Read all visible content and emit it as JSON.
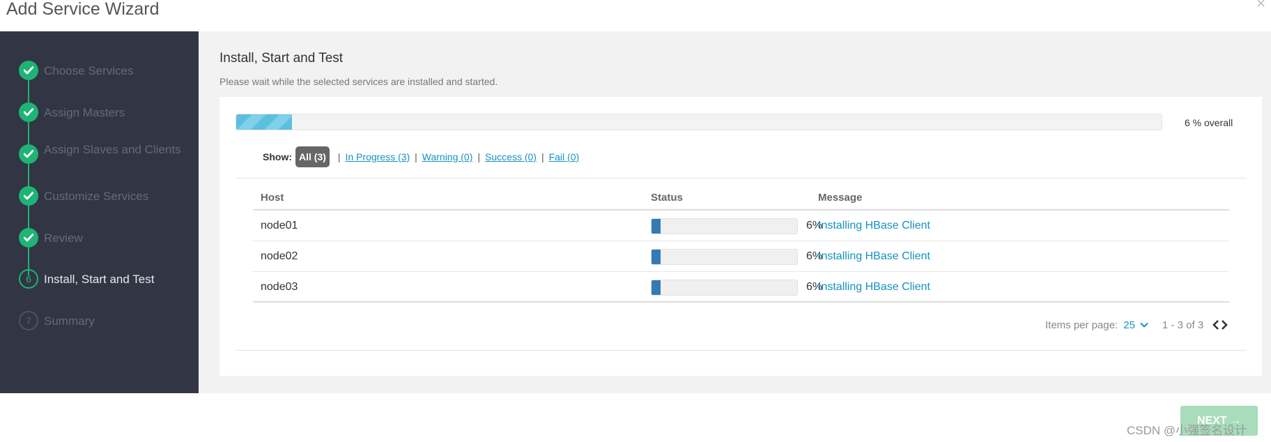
{
  "dialog": {
    "title": "Add Service Wizard",
    "close_glyph": "×"
  },
  "steps": [
    {
      "label": "Choose Services",
      "state": "done",
      "number": ""
    },
    {
      "label": "Assign Masters",
      "state": "done",
      "number": ""
    },
    {
      "label": "Assign Slaves and Clients",
      "state": "done",
      "number": ""
    },
    {
      "label": "Customize Services",
      "state": "done",
      "number": ""
    },
    {
      "label": "Review",
      "state": "done",
      "number": ""
    },
    {
      "label": "Install, Start and Test",
      "state": "current",
      "number": "6"
    },
    {
      "label": "Summary",
      "state": "todo",
      "number": "7"
    }
  ],
  "main": {
    "title": "Install, Start and Test",
    "subtitle": "Please wait while the selected services are installed and started.",
    "overall_progress": 6,
    "overall_text": "6 % overall"
  },
  "filters": {
    "show_label": "Show:",
    "all": "All (3)",
    "in_progress": "In Progress (3)",
    "warning": "Warning (0)",
    "success": "Success (0)",
    "fail": "Fail (0)",
    "separator": "|"
  },
  "table": {
    "headers": {
      "host": "Host",
      "status": "Status",
      "message": "Message"
    },
    "rows": [
      {
        "host": "node01",
        "progress": 6,
        "percent": "6%",
        "message": "Installing HBase Client"
      },
      {
        "host": "node02",
        "progress": 6,
        "percent": "6%",
        "message": "Installing HBase Client"
      },
      {
        "host": "node03",
        "progress": 6,
        "percent": "6%",
        "message": "Installing HBase Client"
      }
    ]
  },
  "pager": {
    "items_per_page_label": "Items per page:",
    "items_per_page": "25",
    "range": "1 - 3 of 3"
  },
  "footer": {
    "next_label": "NEXT →",
    "watermark": "CSDN @小强签名设计"
  },
  "colors": {
    "sidebar_bg": "#323544",
    "step_done": "#1eb475",
    "link": "#1491c1",
    "next_button": "#a8dcbb"
  }
}
